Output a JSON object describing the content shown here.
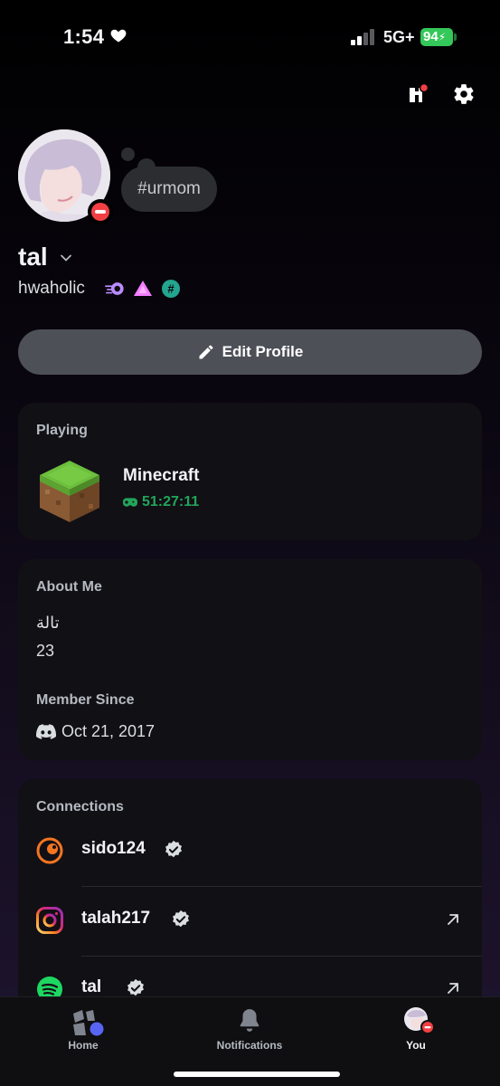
{
  "status_bar": {
    "time": "1:54",
    "network": "5G+",
    "battery": "94"
  },
  "profile": {
    "status_text": "#urmom",
    "display_name": "tal",
    "username": "hwaholic"
  },
  "actions": {
    "edit_profile": "Edit Profile"
  },
  "activity": {
    "heading": "Playing",
    "game": "Minecraft",
    "elapsed": "51:27:11"
  },
  "about": {
    "heading": "About Me",
    "line1": "تالة",
    "line2": "23",
    "member_heading": "Member Since",
    "member_date": "Oct 21, 2017"
  },
  "connections": {
    "heading": "Connections",
    "items": [
      {
        "name": "sido124",
        "service_icon": "crunchyroll-icon"
      },
      {
        "name": "talah217",
        "service_icon": "instagram-icon"
      },
      {
        "name": "tal",
        "service_icon": "spotify-icon"
      }
    ]
  },
  "nav": {
    "home": "Home",
    "notifications": "Notifications",
    "you": "You"
  },
  "colors": {
    "accent": "#5865f2",
    "dnd": "#f23f43",
    "online_green": "#23a55a",
    "battery_green": "#34c759"
  }
}
